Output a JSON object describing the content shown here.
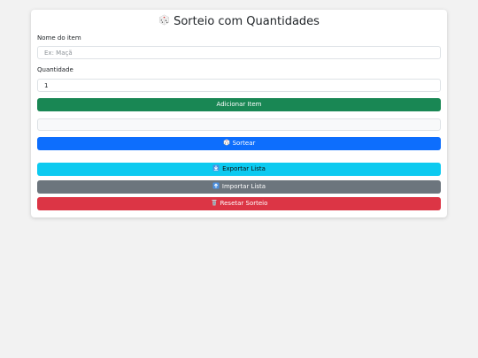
{
  "header": {
    "title": "Sorteio com Quantidades",
    "icon": "dice-icon"
  },
  "form": {
    "item_name_label": "Nome do item",
    "item_name_placeholder": "Ex: Maçã",
    "item_name_value": "",
    "quantity_label": "Quantidade",
    "quantity_value": "1",
    "add_button_label": "Adicionar Item"
  },
  "result": {
    "text": ""
  },
  "actions": {
    "draw_label": "Sortear",
    "export_label": "Exportar Lista",
    "import_label": "Importar Lista",
    "reset_label": "Resetar Sorteio"
  },
  "colors": {
    "page_bg": "#f2f2f2",
    "add": "#198754",
    "draw": "#0d6efd",
    "export": "#0dcaf0",
    "import": "#6c757d",
    "reset": "#dc3545"
  }
}
